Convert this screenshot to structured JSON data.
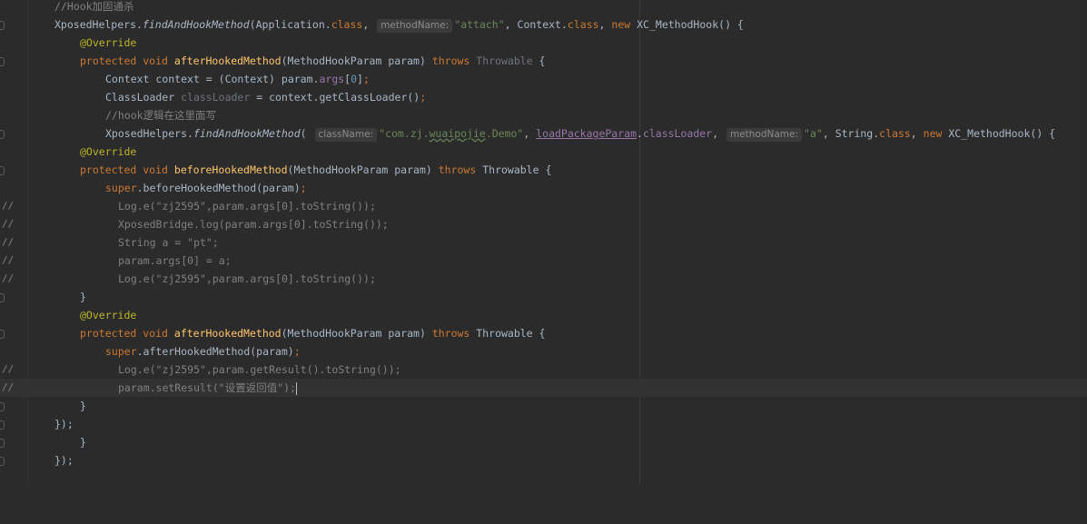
{
  "editor": {
    "lines": [
      {
        "comment": "//Hook加固通杀"
      },
      {
        "cls": "XposedHelpers",
        "method": "findAndHookMethod",
        "arg1": "Application",
        "kw_class": "class",
        "hint": "methodName:",
        "str": "\"attach\"",
        "arg2": "Context",
        "kw_new": "new",
        "type": "XC_MethodHook"
      },
      {
        "ann": "@Override"
      },
      {
        "kw1": "protected",
        "kw2": "void",
        "fn": "afterHookedMethod",
        "ptype": "MethodHookParam",
        "pname": "param",
        "throws": "throws",
        "ex": "Throwable"
      },
      {
        "type": "Context",
        "var": "context",
        "cast": "(Context)",
        "obj": "param",
        "field": "args",
        "idx": "0"
      },
      {
        "type": "ClassLoader",
        "var": "classLoader",
        "expr": "context.getClassLoader()"
      },
      {
        "comment": "//hook逻辑在这里面写"
      },
      {
        "cls": "XposedHelpers",
        "method": "findAndHookMethod",
        "hint1": "className:",
        "str1": "\"com.zj.wuaipojie.Demo\"",
        "param": "loadPackageParam",
        "field": "classLoader",
        "hint2": "methodName:",
        "str2": "\"a\"",
        "arg": "String",
        "kw_class": "class",
        "kw_new": "new",
        "type": "XC_MethodHook"
      },
      {
        "ann": "@Override"
      },
      {
        "kw1": "protected",
        "kw2": "void",
        "fn": "beforeHookedMethod",
        "ptype": "MethodHookParam",
        "pname": "param",
        "throws": "throws",
        "ex": "Throwable"
      },
      {
        "kw": "super",
        "rest": ".beforeHookedMethod(param)"
      },
      {
        "gutter": "//",
        "text": "Log.e(\"zj2595\",param.args[0].toString());"
      },
      {
        "gutter": "//",
        "text": "XposedBridge.log(param.args[0].toString());"
      },
      {
        "gutter": "//",
        "text": "String a = \"pt\";"
      },
      {
        "gutter": "//",
        "text": "param.args[0] = a;"
      },
      {
        "gutter": "//",
        "text": "Log.e(\"zj2595\",param.args[0].toString());"
      },
      {
        "brace": "}"
      },
      {
        "ann": "@Override"
      },
      {
        "kw1": "protected",
        "kw2": "void",
        "fn": "afterHookedMethod",
        "ptype": "MethodHookParam",
        "pname": "param",
        "throws": "throws",
        "ex": "Throwable"
      },
      {
        "kw": "super",
        "rest": ".afterHookedMethod(param)"
      },
      {
        "gutter": "//",
        "text": "Log.e(\"zj2595\",param.getResult().toString());"
      },
      {
        "gutter": "//",
        "text": "param.setResult(\"设置返回值\");"
      },
      {
        "brace": "}"
      },
      {
        "brace": "});"
      },
      {
        "brace": "}"
      },
      {
        "brace": "});"
      }
    ]
  }
}
